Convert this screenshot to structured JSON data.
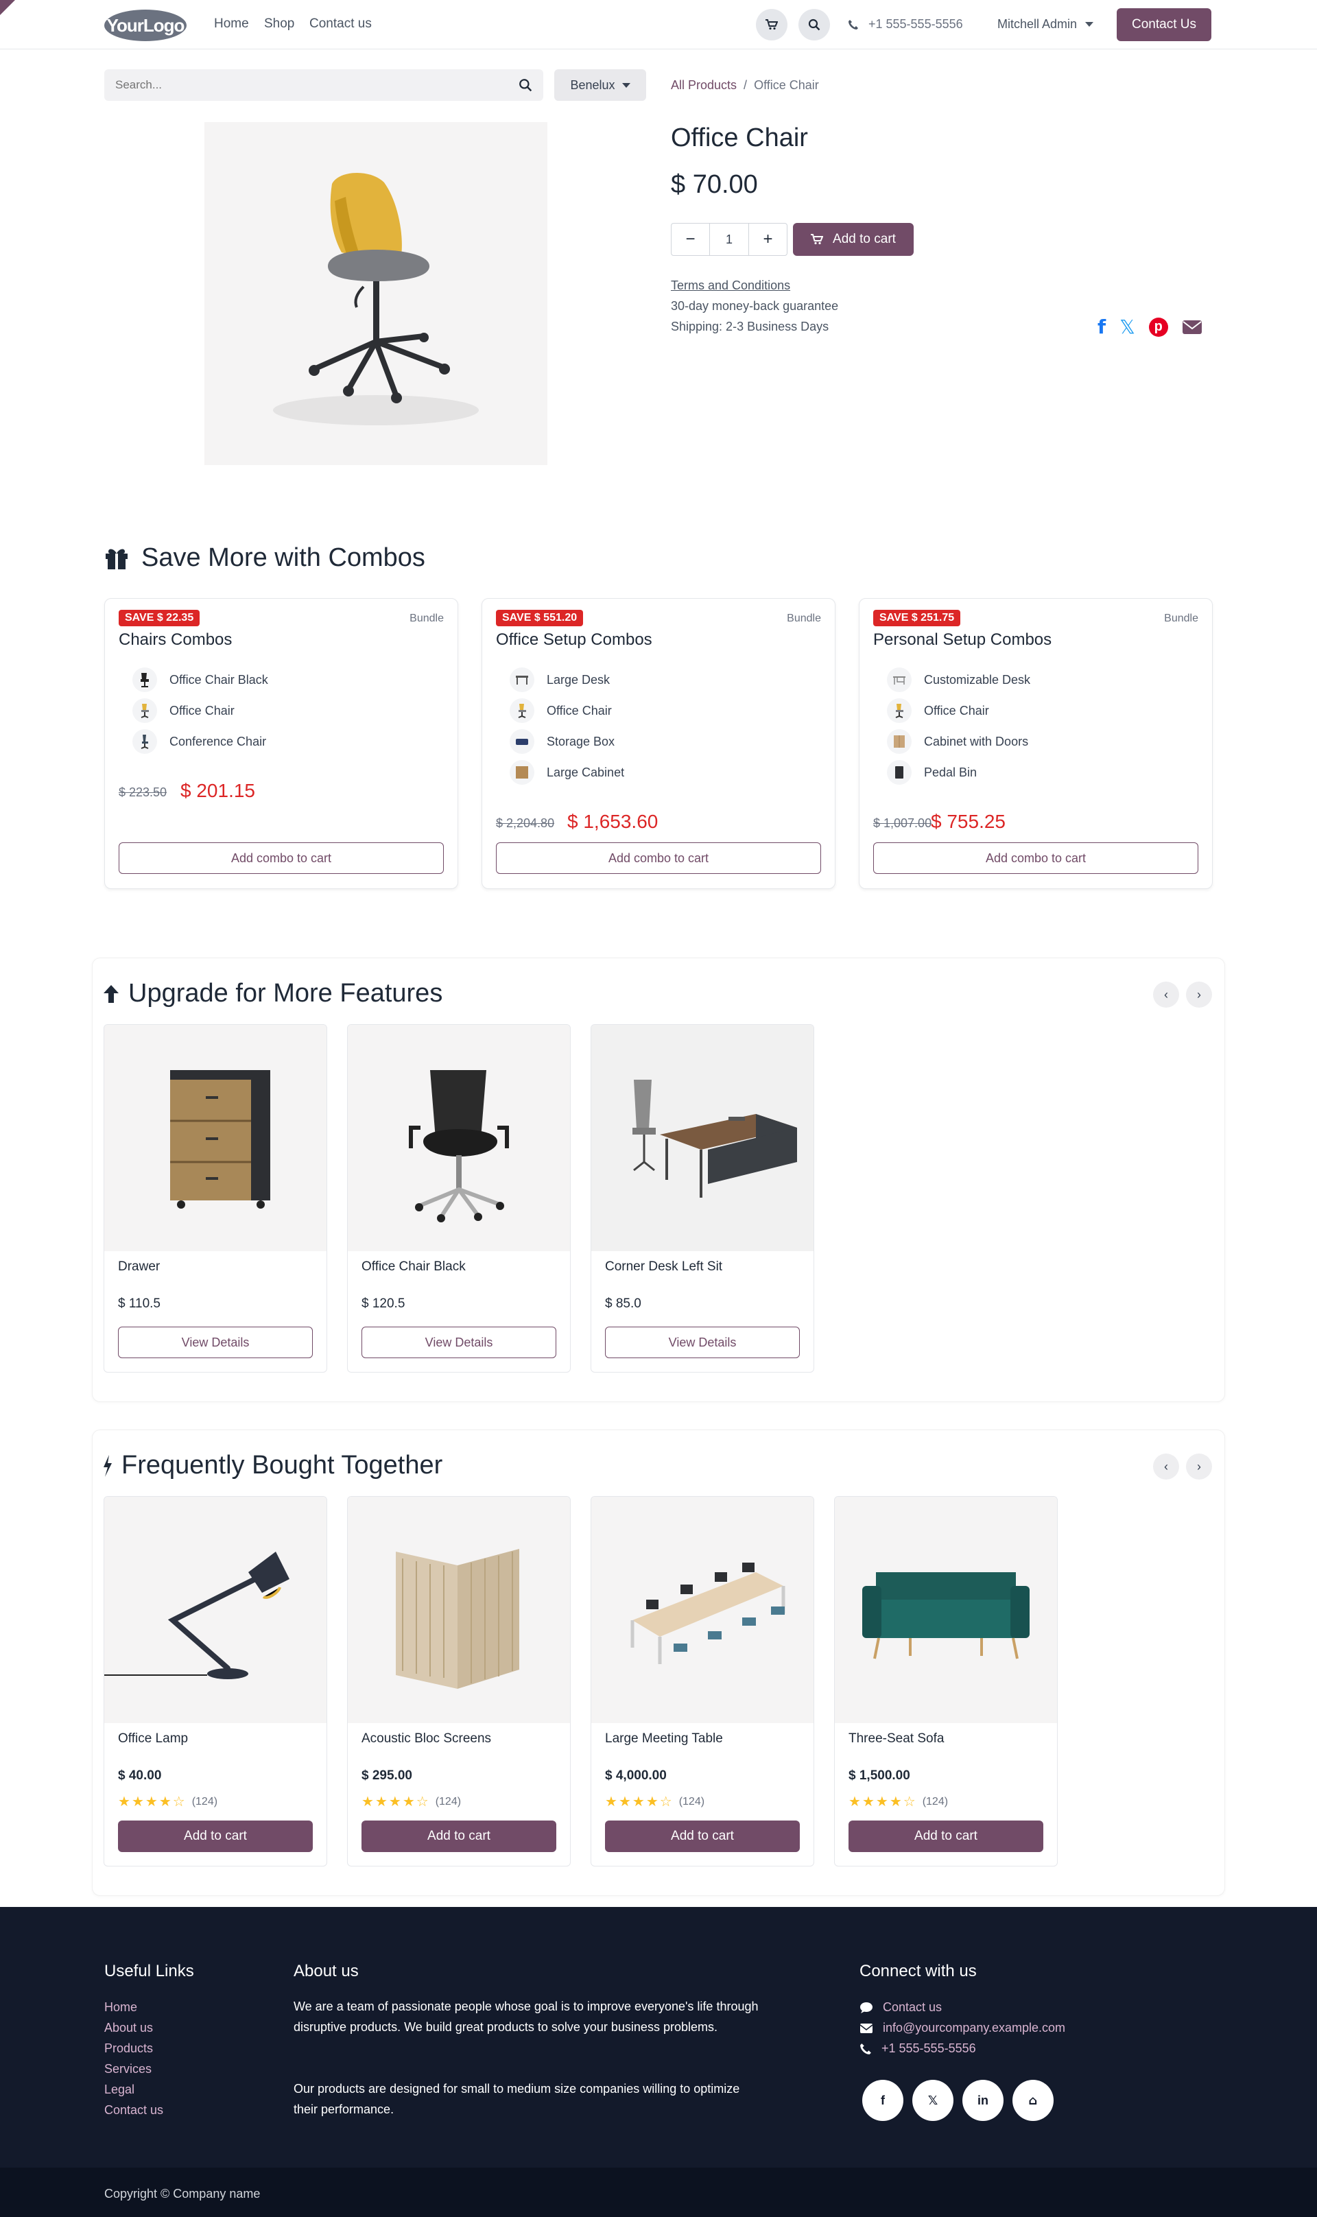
{
  "header": {
    "logo": "YourLogo",
    "nav": [
      "Home",
      "Shop",
      "Contact us"
    ],
    "phone": "+1 555-555-5556",
    "user": "Mitchell Admin",
    "contact_button": "Contact Us"
  },
  "search": {
    "placeholder": "Search...",
    "pricelist": "Benelux"
  },
  "breadcrumb": {
    "parent": "All Products",
    "separator": "/",
    "current": "Office Chair"
  },
  "product": {
    "name": "Office Chair",
    "price": "$ 70.00",
    "quantity": "1",
    "add_to_cart": "Add to cart",
    "terms": "Terms and Conditions",
    "guarantee": "30-day money-back guarantee",
    "shipping": "Shipping: 2-3 Business Days",
    "share_icons": [
      "facebook-icon",
      "x-icon",
      "pinterest-icon",
      "email-icon"
    ]
  },
  "combos": {
    "title": "Save More with Combos",
    "cards": [
      {
        "badge": "SAVE $ 22.35",
        "tag": "Bundle",
        "name": "Chairs Combos",
        "items": [
          "Office Chair Black",
          "Office Chair",
          "Conference Chair"
        ],
        "old_price": "$ 223.50",
        "new_price": "$ 201.15",
        "button": "Add combo to cart"
      },
      {
        "badge": "SAVE $ 551.20",
        "tag": "Bundle",
        "name": "Office Setup Combos",
        "items": [
          "Large Desk",
          "Office Chair",
          "Storage Box",
          "Large Cabinet"
        ],
        "old_price": "$ 2,204.80",
        "new_price": "$ 1,653.60",
        "button": "Add combo to cart"
      },
      {
        "badge": "SAVE $ 251.75",
        "tag": "Bundle",
        "name": "Personal Setup Combos",
        "items": [
          "Customizable Desk",
          "Office Chair",
          "Cabinet with Doors",
          "Pedal Bin"
        ],
        "old_price": "$ 1,007.00",
        "new_price": "$ 755.25",
        "button": "Add combo to cart"
      }
    ]
  },
  "upgrade": {
    "title": "Upgrade for More Features",
    "products": [
      {
        "name": "Drawer",
        "price": "$ 110.5",
        "button": "View Details"
      },
      {
        "name": "Office Chair Black",
        "price": "$ 120.5",
        "button": "View Details"
      },
      {
        "name": "Corner Desk Left Sit",
        "price": "$ 85.0",
        "button": "View Details"
      }
    ]
  },
  "fbt": {
    "title": "Frequently Bought Together",
    "products": [
      {
        "name": "Office Lamp",
        "price": "$ 40.00",
        "rating": 4,
        "reviews": "(124)",
        "button": "Add to cart"
      },
      {
        "name": "Acoustic Bloc Screens",
        "price": "$ 295.00",
        "rating": 4,
        "reviews": "(124)",
        "button": "Add to cart"
      },
      {
        "name": "Large Meeting Table",
        "price": "$ 4,000.00",
        "rating": 4,
        "reviews": "(124)",
        "button": "Add to cart"
      },
      {
        "name": "Three-Seat Sofa",
        "price": "$ 1,500.00",
        "rating": 4,
        "reviews": "(124)",
        "button": "Add to cart"
      }
    ]
  },
  "footer": {
    "useful_links_title": "Useful Links",
    "useful_links": [
      "Home",
      "About us",
      "Products",
      "Services",
      "Legal",
      "Contact us"
    ],
    "about_title": "About us",
    "about_p1": "We are a team of passionate people whose goal is to improve everyone's life through disruptive products. We build great products to solve your business problems.",
    "about_p2": "Our products are designed for small to medium size companies willing to optimize their performance.",
    "connect_title": "Connect with us",
    "connect": [
      "Contact us",
      "info@yourcompany.example.com",
      "+1 555-555-5556"
    ],
    "social": [
      "f",
      "𝕏",
      "in",
      "⌂"
    ],
    "copyright": "Copyright © Company name"
  },
  "colors": {
    "brand": "#714b67",
    "sale": "#dc2626",
    "footer": "#131a2b",
    "star": "#fbbf24"
  }
}
